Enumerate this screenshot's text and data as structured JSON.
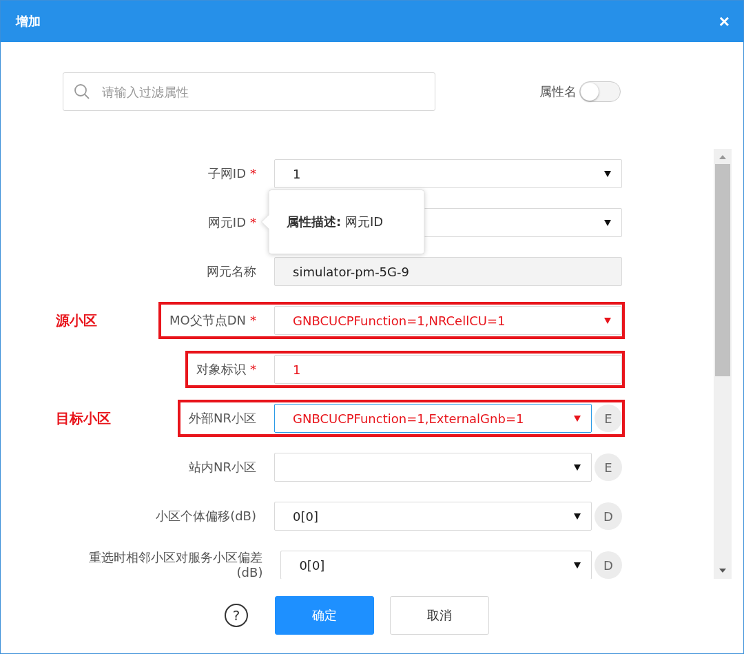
{
  "window": {
    "title": "增加",
    "close": "×"
  },
  "filter": {
    "placeholder": "请输入过滤属性",
    "toggle_label": "属性名",
    "toggle_on": false
  },
  "fields": [
    {
      "label": "子网ID",
      "required_mark": "*",
      "kind": "select",
      "value": "1"
    },
    {
      "label": "网元ID",
      "required_mark": "*",
      "kind": "select",
      "tooltip": "**属性描述:** 网元ID"
    },
    {
      "label": "网元名称",
      "kind": "readonly",
      "value": "simulator-pm-5G-9"
    },
    {
      "label": "MO父节点DN",
      "required_mark": "*",
      "kind": "select",
      "value": "GNBCUCPFunction=1,NRCellCU=1",
      "highlight": true,
      "framed": true,
      "annotation": "源小区"
    },
    {
      "label": "对象标识",
      "required_mark": "*",
      "kind": "text",
      "value": "1",
      "highlight": true,
      "framed": true
    },
    {
      "label": "外部NR小区",
      "kind": "select",
      "value": "GNBCUCPFunction=1,ExternalGnb=1",
      "highlight": true,
      "focused": true,
      "side_button": "E",
      "framed": true,
      "annotation": "目标小区"
    },
    {
      "label": "站内NR小区",
      "kind": "select",
      "side_button": "E"
    },
    {
      "label": "小区个体偏移(dB)",
      "kind": "select",
      "value": "0[0]",
      "side_button": "D"
    },
    {
      "label": "重选时相邻小区对服务小区偏差(dB)",
      "kind": "select",
      "value": "0[0]",
      "side_button": "D"
    }
  ],
  "footer": {
    "help": "?",
    "buttons": [
      {
        "label": "确定",
        "kind": "primary"
      },
      {
        "label": "取消",
        "kind": "default"
      }
    ]
  }
}
